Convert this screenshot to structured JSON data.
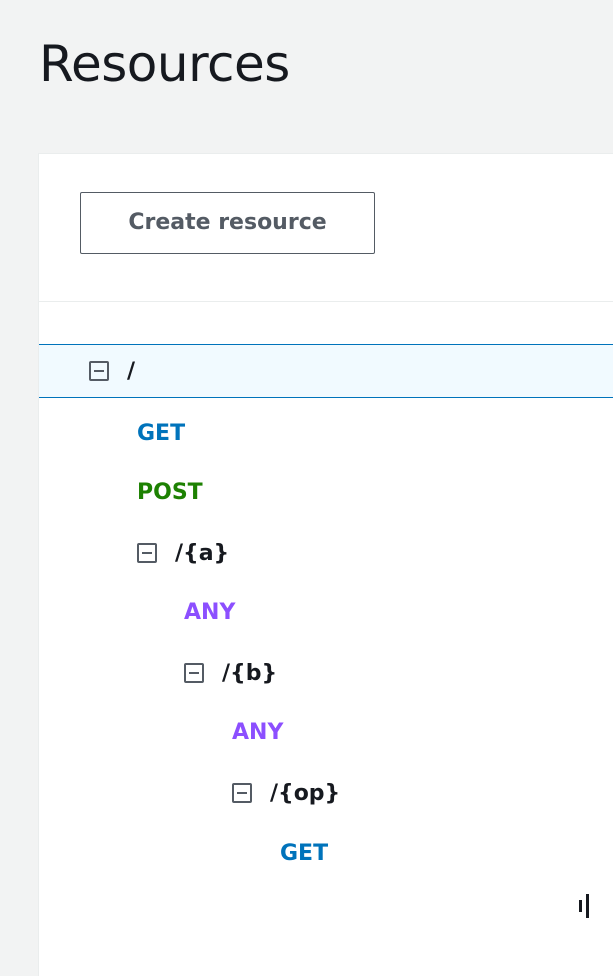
{
  "page": {
    "title": "Resources"
  },
  "toolbar": {
    "create_label": "Create resource"
  },
  "tree": {
    "root": "/",
    "root_get": "GET",
    "root_post": "POST",
    "a": "/{a}",
    "a_any": "ANY",
    "b": "/{b}",
    "b_any": "ANY",
    "op": "/{op}",
    "op_get": "GET"
  },
  "colors": {
    "get": "#0073bb",
    "post": "#1d8102",
    "any": "#8c4fff",
    "selected_border": "#0073bb",
    "selected_bg": "#f1faff"
  },
  "icons": {
    "toggle": "collapse-minus-icon"
  }
}
